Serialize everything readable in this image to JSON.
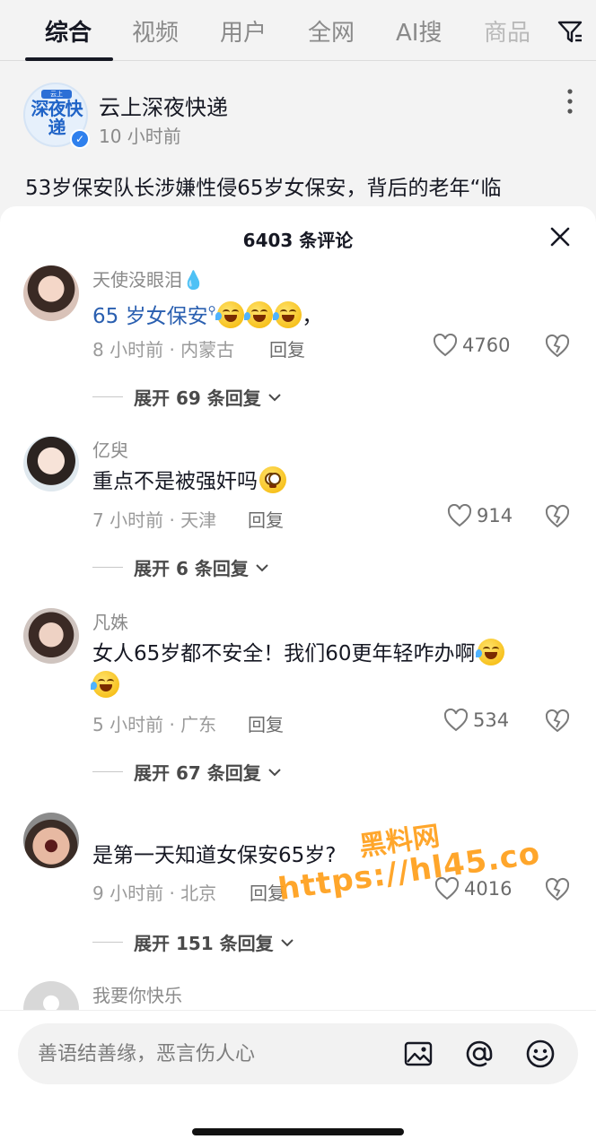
{
  "tabs": [
    {
      "label": "综合",
      "active": true
    },
    {
      "label": "视频",
      "active": false
    },
    {
      "label": "用户",
      "active": false
    },
    {
      "label": "全网",
      "active": false
    },
    {
      "label": "AI搜",
      "active": false
    },
    {
      "label": "商品",
      "active": false
    }
  ],
  "post": {
    "account_name": "云上深夜快递",
    "avatar_text": "深夜快递",
    "avatar_badge": "云上",
    "time": "10 小时前",
    "text": "53岁保安队长涉嫌性侵65岁女保安，背后的老年“临"
  },
  "sheet": {
    "title": "6403 条评论"
  },
  "comments": [
    {
      "name": "天使没眼泪💧",
      "text_link": "65 岁女保安",
      "text_suffix": "，",
      "meta": "8 小时前 · 内蒙古",
      "reply": "回复",
      "likes": "4760",
      "expand": "展开 69 条回复"
    },
    {
      "name": "亿臾",
      "text": "重点不是被强奸吗",
      "meta": "7 小时前 · 天津",
      "reply": "回复",
      "likes": "914",
      "expand": "展开 6 条回复"
    },
    {
      "name": "凡姝",
      "text": "女人65岁都不安全！我们60更年轻咋办啊",
      "meta": "5 小时前 · 广东",
      "reply": "回复",
      "likes": "534",
      "expand": "展开 67 条回复"
    },
    {
      "name": "",
      "text": "是第一天知道女保安65岁?",
      "meta": "9 小时前 · 北京",
      "reply": "回复",
      "likes": "4016",
      "expand": "展开 151 条回复"
    },
    {
      "name": "我要你快乐"
    }
  ],
  "watermark": {
    "line1": "黑料网",
    "line2": "https://hl45.co"
  },
  "input": {
    "placeholder": "善语结善缘，恶言伤人心"
  },
  "colors": {
    "link": "#2a5fb0",
    "watermark": "#ff9f1a",
    "verified": "#2f80ed"
  }
}
